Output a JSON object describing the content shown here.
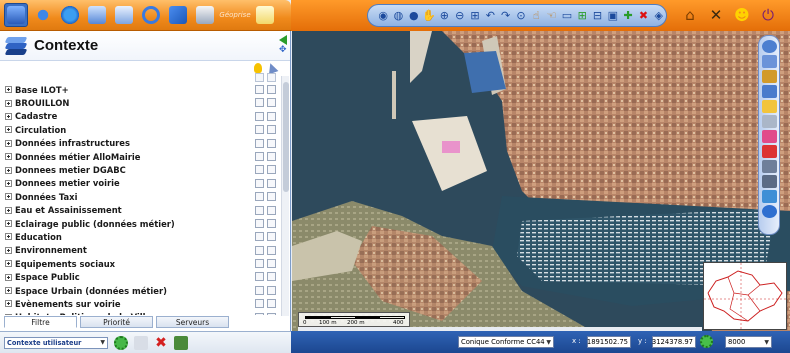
{
  "context_panel": {
    "title": "Contexte"
  },
  "layers": [
    "Base ILOT+",
    "BROUILLON",
    "Cadastre",
    "Circulation",
    "Données infrastructures",
    "Données métier AlloMairie",
    "Donnees metier DGABC",
    "Donnees metier voirie",
    "Données Taxi",
    "Eau et Assainissement",
    "Eclairage public (données métier)",
    "Education",
    "Environnement",
    "Equipements sociaux",
    "Espace Public",
    "Espace Urbain (données métier)",
    "Evènements sur voirie",
    "Habitat - Politique de la Ville"
  ],
  "tabs": {
    "filtre": "Filtre",
    "priorite": "Priorité",
    "serveurs": "Serveurs"
  },
  "status": {
    "context_select": "Contexte utilisateur",
    "projection": "Conique Conforme CC44",
    "x_label": "x :",
    "x_value": "1891502.75",
    "y_label": "y :",
    "y_value": "3124378.97",
    "scale": "8000"
  },
  "scalebar": {
    "l0": "0",
    "l1": "100 m",
    "l2": "200 m",
    "l3": "400 m"
  },
  "toolbar": {
    "logo_text": "Géoprise"
  },
  "colors": {
    "toolbar_orange": "#f08a1c",
    "accent_blue": "#3b6fc2",
    "status_blue": "#1c4790"
  }
}
